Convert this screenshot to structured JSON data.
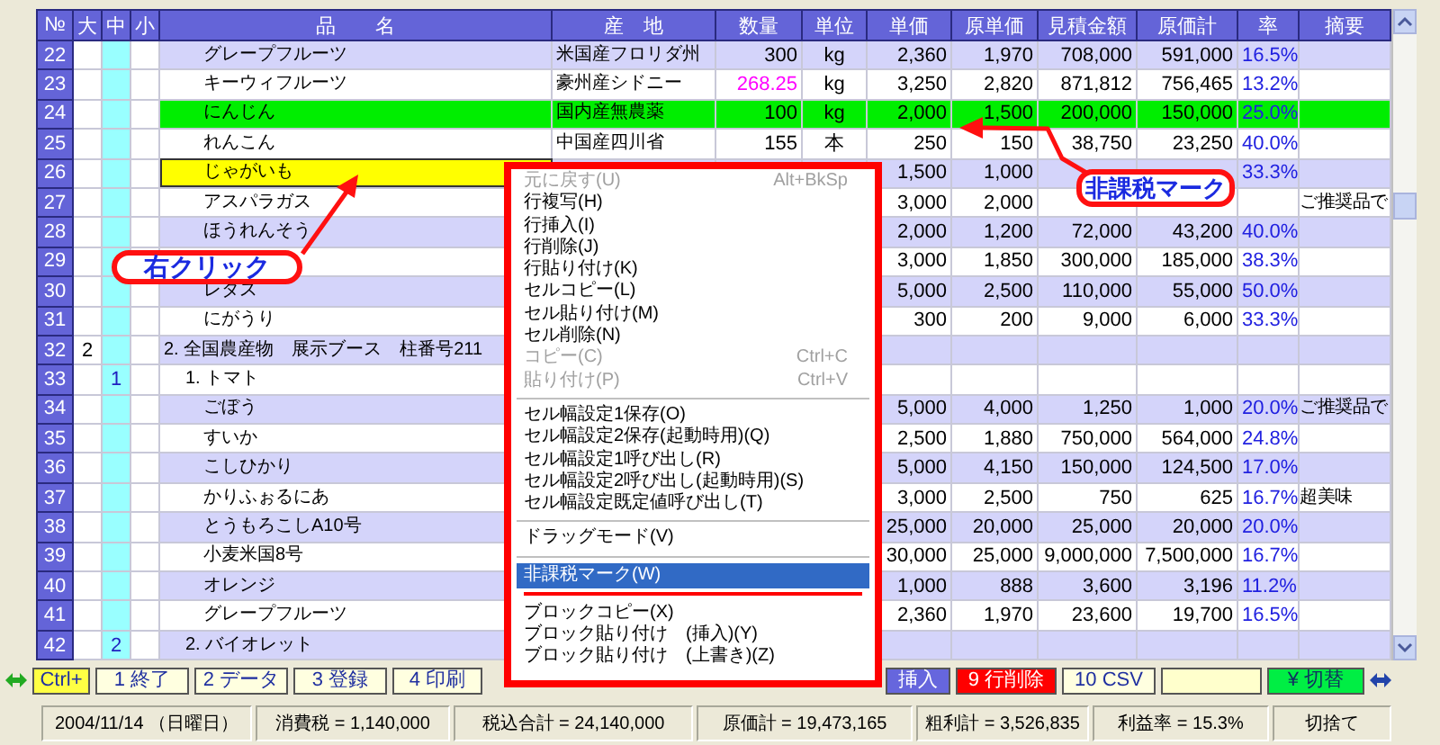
{
  "table": {
    "columns": [
      "№",
      "大",
      "中",
      "小",
      "品　　名",
      "産　地",
      "数量",
      "単位",
      "単価",
      "原単価",
      "見積金額",
      "原価計",
      "率",
      "摘要"
    ],
    "rows": [
      {
        "no": "22",
        "name": "グレープフルーツ",
        "origin": "米国産フロリダ州",
        "qty": "300",
        "unit": "kg",
        "price": "2,360",
        "cost_price": "1,970",
        "amount": "708,000",
        "cost_total": "591,000",
        "rate": "16.5%",
        "kind": "item",
        "tax_exempt": false,
        "selected": false,
        "qty_modified": false
      },
      {
        "no": "23",
        "name": "キーウィフルーツ",
        "origin": "豪州産シドニー",
        "qty": "268.25",
        "unit": "kg",
        "price": "3,250",
        "cost_price": "2,820",
        "amount": "871,812",
        "cost_total": "756,465",
        "rate": "13.2%",
        "kind": "item",
        "tax_exempt": false,
        "selected": false,
        "qty_modified": true
      },
      {
        "no": "24",
        "name": "にんじん",
        "origin": "国内産無農薬",
        "qty": "100",
        "unit": "kg",
        "price": "2,000",
        "cost_price": "1,500",
        "amount": "200,000",
        "cost_total": "150,000",
        "rate": "25.0%",
        "kind": "item",
        "tax_exempt": true,
        "selected": false,
        "qty_modified": false
      },
      {
        "no": "25",
        "name": "れんこん",
        "origin": "中国産四川省",
        "qty": "155",
        "unit": "本",
        "price": "250",
        "cost_price": "150",
        "amount": "38,750",
        "cost_total": "23,250",
        "rate": "40.0%",
        "kind": "item",
        "tax_exempt": false,
        "selected": false,
        "qty_modified": false
      },
      {
        "no": "26",
        "name": "じゃがいも",
        "price": "1,500",
        "cost_price": "1,000",
        "rate": "33.3%",
        "kind": "item",
        "tax_exempt": false,
        "selected": true
      },
      {
        "no": "27",
        "name": "アスパラガス",
        "price": "3,000",
        "cost_price": "2,000",
        "note": "ご推奨品で",
        "kind": "item",
        "tax_exempt": false,
        "selected": false
      },
      {
        "no": "28",
        "name": "ほうれんそう",
        "price": "2,000",
        "cost_price": "1,200",
        "amount": "72,000",
        "cost_total": "43,200",
        "rate": "40.0%",
        "kind": "item",
        "tax_exempt": false,
        "selected": false
      },
      {
        "no": "29",
        "price": "3,000",
        "cost_price": "1,850",
        "amount": "300,000",
        "cost_total": "185,000",
        "rate": "38.3%",
        "kind": "item",
        "tax_exempt": false,
        "selected": false
      },
      {
        "no": "30",
        "name": "レタス",
        "price": "5,000",
        "cost_price": "2,500",
        "amount": "110,000",
        "cost_total": "55,000",
        "rate": "50.0%",
        "kind": "item",
        "tax_exempt": false,
        "selected": false
      },
      {
        "no": "31",
        "name": "にがうり",
        "price": "300",
        "cost_price": "200",
        "amount": "9,000",
        "cost_total": "6,000",
        "rate": "33.3%",
        "kind": "item",
        "tax_exempt": false,
        "selected": false
      },
      {
        "no": "32",
        "major": "2",
        "name": "2. 全国農産物　展示ブース　柱番号211",
        "kind": "group",
        "tax_exempt": false,
        "selected": false
      },
      {
        "no": "33",
        "middle": "1",
        "name": "1. トマト",
        "kind": "subgroup",
        "tax_exempt": false,
        "selected": false
      },
      {
        "no": "34",
        "name": "ごぼう",
        "price": "5,000",
        "cost_price": "4,000",
        "amount": "1,250",
        "cost_total": "1,000",
        "rate": "20.0%",
        "note": "ご推奨品で",
        "kind": "item",
        "tax_exempt": false,
        "selected": false
      },
      {
        "no": "35",
        "name": "すいか",
        "price": "2,500",
        "cost_price": "1,880",
        "amount": "750,000",
        "cost_total": "564,000",
        "rate": "24.8%",
        "kind": "item",
        "tax_exempt": false,
        "selected": false
      },
      {
        "no": "36",
        "name": "こしひかり",
        "price": "5,000",
        "cost_price": "4,150",
        "amount": "150,000",
        "cost_total": "124,500",
        "rate": "17.0%",
        "kind": "item",
        "tax_exempt": false,
        "selected": false
      },
      {
        "no": "37",
        "name": "かりふぉるにあ",
        "price": "3,000",
        "cost_price": "2,500",
        "amount": "750",
        "cost_total": "625",
        "rate": "16.7%",
        "note": "超美味",
        "kind": "item",
        "tax_exempt": false,
        "selected": false
      },
      {
        "no": "38",
        "name": "とうもろこしA10号",
        "price": "25,000",
        "cost_price": "20,000",
        "amount": "25,000",
        "cost_total": "20,000",
        "rate": "20.0%",
        "kind": "item",
        "tax_exempt": false,
        "selected": false
      },
      {
        "no": "39",
        "name": "小麦米国8号",
        "price": "30,000",
        "cost_price": "25,000",
        "amount": "9,000,000",
        "cost_total": "7,500,000",
        "rate": "16.7%",
        "kind": "item",
        "tax_exempt": false,
        "selected": false
      },
      {
        "no": "40",
        "name": "オレンジ",
        "price": "1,000",
        "cost_price": "888",
        "amount": "3,600",
        "cost_total": "3,196",
        "rate": "11.2%",
        "kind": "item",
        "tax_exempt": false,
        "selected": false
      },
      {
        "no": "41",
        "name": "グレープフルーツ",
        "price": "2,360",
        "cost_price": "1,970",
        "amount": "23,600",
        "cost_total": "19,700",
        "rate": "16.5%",
        "kind": "item",
        "tax_exempt": false,
        "selected": false
      },
      {
        "no": "42",
        "middle": "2",
        "name": "2. バイオレット",
        "kind": "subgroup",
        "tax_exempt": false,
        "selected": false
      }
    ]
  },
  "context_menu": {
    "items": [
      {
        "kind": "item",
        "label": "元に戻す(U)",
        "shortcut": "Alt+BkSp",
        "disabled": true,
        "selected": false
      },
      {
        "kind": "item",
        "label": "行複写(H)",
        "disabled": false,
        "selected": false
      },
      {
        "kind": "item",
        "label": "行挿入(I)",
        "disabled": false,
        "selected": false
      },
      {
        "kind": "item",
        "label": "行削除(J)",
        "disabled": false,
        "selected": false
      },
      {
        "kind": "item",
        "label": "行貼り付け(K)",
        "disabled": false,
        "selected": false
      },
      {
        "kind": "item",
        "label": "セルコピー(L)",
        "disabled": false,
        "selected": false
      },
      {
        "kind": "item",
        "label": "セル貼り付け(M)",
        "disabled": false,
        "selected": false
      },
      {
        "kind": "item",
        "label": "セル削除(N)",
        "disabled": false,
        "selected": false
      },
      {
        "kind": "item",
        "label": "コピー(C)",
        "shortcut": "Ctrl+C",
        "disabled": true,
        "selected": false
      },
      {
        "kind": "item",
        "label": "貼り付け(P)",
        "shortcut": "Ctrl+V",
        "disabled": true,
        "selected": false
      },
      {
        "kind": "separator"
      },
      {
        "kind": "item",
        "label": "セル幅設定1保存(O)",
        "disabled": false,
        "selected": false
      },
      {
        "kind": "item",
        "label": "セル幅設定2保存(起動時用)(Q)",
        "disabled": false,
        "selected": false
      },
      {
        "kind": "item",
        "label": "セル幅設定1呼び出し(R)",
        "disabled": false,
        "selected": false
      },
      {
        "kind": "item",
        "label": "セル幅設定2呼び出し(起動時用)(S)",
        "disabled": false,
        "selected": false
      },
      {
        "kind": "item",
        "label": "セル幅設定既定値呼び出し(T)",
        "disabled": false,
        "selected": false
      },
      {
        "kind": "separator"
      },
      {
        "kind": "item",
        "label": "ドラッグモード(V)",
        "disabled": false,
        "selected": false
      },
      {
        "kind": "separator"
      },
      {
        "kind": "item",
        "label": "非課税マーク(W)",
        "disabled": false,
        "selected": true
      },
      {
        "kind": "item",
        "label": "ブロックコピー(X)",
        "disabled": false,
        "selected": false
      },
      {
        "kind": "item",
        "label": "ブロック貼り付け　(挿入)(Y)",
        "disabled": false,
        "selected": false
      },
      {
        "kind": "item",
        "label": "ブロック貼り付け　(上書き)(Z)",
        "disabled": false,
        "selected": false
      }
    ]
  },
  "callouts": [
    {
      "text": "右クリック"
    },
    {
      "text": "非課税マーク"
    }
  ],
  "function_keys": {
    "left": [
      {
        "label": "Ctrl+",
        "color": "#ffff44"
      },
      {
        "label": "1 終了",
        "color": "#ffffe0"
      },
      {
        "label": "2 データ",
        "color": "#ffffe0"
      },
      {
        "label": "3 登録",
        "color": "#ffffe0"
      },
      {
        "label": "4 印刷",
        "color": "#ffffe0"
      }
    ],
    "right": [
      {
        "label": "挿入",
        "color": "#6666dd"
      },
      {
        "label": "9 行削除",
        "color": "#ff0000"
      },
      {
        "label": "10 CSV",
        "color": "#ffffe0"
      },
      {
        "color": "#ffffcc"
      },
      {
        "label": "¥ 切替",
        "color": "#00ee44"
      }
    ]
  },
  "status_bar": [
    "2004/11/14 （日曜日）",
    "消費税 = 1,140,000",
    "税込合計 = 24,140,000",
    "原価計 = 19,473,165",
    "粗利計 = 3,526,835",
    "利益率 = 15.3%",
    "切捨て"
  ]
}
